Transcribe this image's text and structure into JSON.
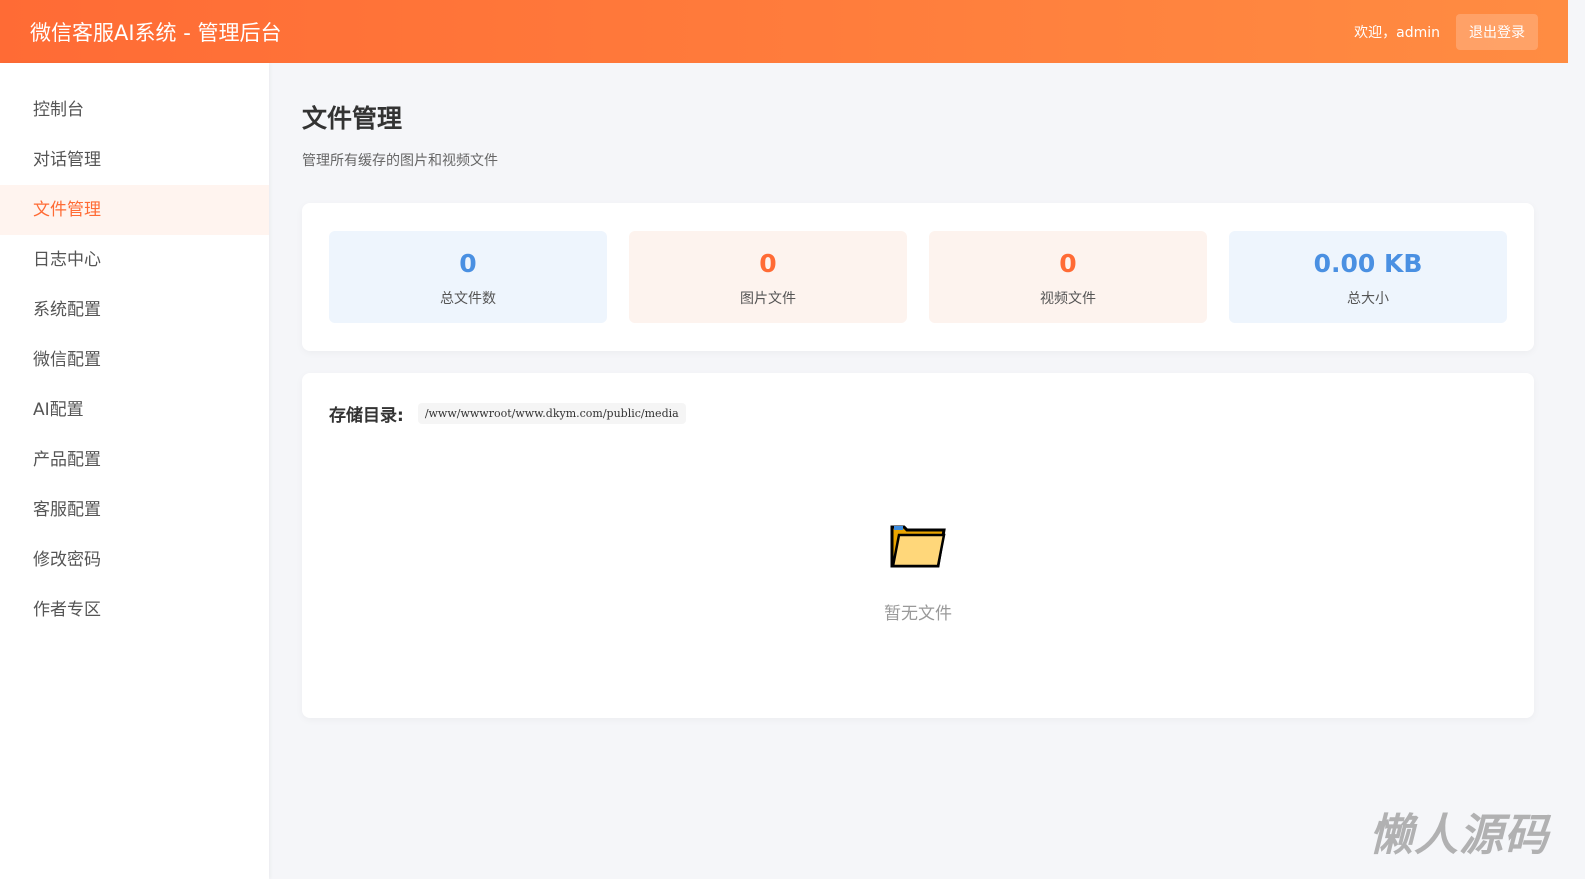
{
  "header": {
    "title": "微信客服AI系统 - 管理后台",
    "welcome": "欢迎，admin",
    "logout": "退出登录"
  },
  "sidebar": {
    "items": [
      {
        "label": "控制台"
      },
      {
        "label": "对话管理"
      },
      {
        "label": "文件管理",
        "active": true
      },
      {
        "label": "日志中心"
      },
      {
        "label": "系统配置"
      },
      {
        "label": "微信配置"
      },
      {
        "label": "AI配置"
      },
      {
        "label": "产品配置"
      },
      {
        "label": "客服配置"
      },
      {
        "label": "修改密码"
      },
      {
        "label": "作者专区"
      }
    ]
  },
  "page": {
    "title": "文件管理",
    "subtitle": "管理所有缓存的图片和视频文件"
  },
  "stats": [
    {
      "value": "0",
      "label": "总文件数"
    },
    {
      "value": "0",
      "label": "图片文件"
    },
    {
      "value": "0",
      "label": "视频文件"
    },
    {
      "value": "0.00 KB",
      "label": "总大小"
    }
  ],
  "files": {
    "dir_label": "存储目录:",
    "dir_path": "/www/wwwroot/www.dkym.com/public/media",
    "empty_text": "暂无文件",
    "empty_icon": "folder-icon"
  },
  "watermark": "懒人源码",
  "colors": {
    "accent": "#ff6b35",
    "blue": "#4a90e2"
  }
}
